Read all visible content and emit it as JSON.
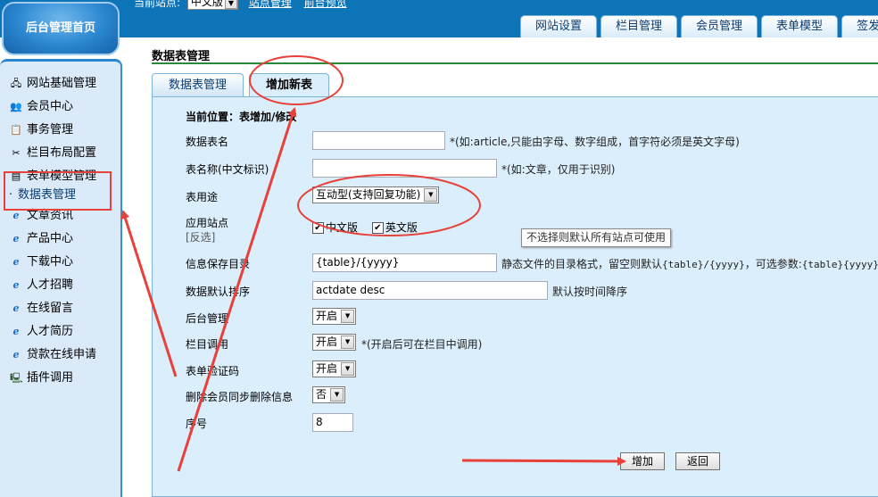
{
  "topbar": {
    "site_label": "当前站点:",
    "site_value": "中文版",
    "links": [
      "站点管理",
      "前台预览"
    ]
  },
  "top_nav": [
    "网站设置",
    "栏目管理",
    "会员管理",
    "表单模型",
    "签发信息"
  ],
  "home_button": "后台管理首页",
  "sidebar": {
    "items": [
      {
        "label": "网站基础管理",
        "icon": "network-icon"
      },
      {
        "label": "会员中心",
        "icon": "users-icon"
      },
      {
        "label": "事务管理",
        "icon": "clipboard-icon"
      },
      {
        "label": "栏目布局配置",
        "icon": "tools-icon"
      },
      {
        "label": "表单模型管理",
        "icon": "form-icon"
      },
      {
        "label": "数据表管理",
        "icon": "dot"
      },
      {
        "label": "文章资讯",
        "icon": "ie-icon"
      },
      {
        "label": "产品中心",
        "icon": "ie-icon"
      },
      {
        "label": "下载中心",
        "icon": "ie-icon"
      },
      {
        "label": "人才招聘",
        "icon": "ie-icon"
      },
      {
        "label": "在线留言",
        "icon": "ie-icon"
      },
      {
        "label": "人才简历",
        "icon": "ie-icon"
      },
      {
        "label": "贷款在线申请",
        "icon": "ie-icon"
      },
      {
        "label": "插件调用",
        "icon": "computer-icon"
      }
    ]
  },
  "main": {
    "page_title": "数据表管理",
    "tabs": [
      "数据表管理",
      "增加新表"
    ],
    "breadcrumb": "当前位置：表增加/修改",
    "form": {
      "table_name": {
        "label": "数据表名",
        "value": "",
        "hint": "*(如:article,只能由字母、数字组成，首字符必须是英文字母)"
      },
      "display_name": {
        "label": "表名称(中文标识)",
        "value": "",
        "hint": "*(如:文章，仅用于识别)"
      },
      "usage": {
        "label": "表用途",
        "value": "互动型(支持回复功能)"
      },
      "sites": {
        "label": "应用站点",
        "sublabel": "[反选]",
        "options": [
          {
            "label": "中文版",
            "checked": true
          },
          {
            "label": "英文版",
            "checked": true
          }
        ]
      },
      "save_dir": {
        "label": "信息保存目录",
        "value": "{table}/{yyyy}",
        "hint_prefix": "静态文件的目录格式，留空则默认",
        "hint_default": "{table}/{yyyy}",
        "hint_mid": "，可选参数:",
        "hint_params": "{table}{yyyy}{mm}"
      },
      "sort": {
        "label": "数据默认排序",
        "value": "actdate desc",
        "hint": "默认按时间降序"
      },
      "admin": {
        "label": "后台管理",
        "value": "开启"
      },
      "column_call": {
        "label": "栏目调用",
        "value": "开启",
        "hint": "*(开启后可在栏目中调用)"
      },
      "captcha": {
        "label": "表单验证码",
        "value": "开启"
      },
      "delete_sync": {
        "label": "删除会员同步删除信息",
        "value": "否"
      },
      "order": {
        "label": "序号",
        "value": "8"
      }
    },
    "tooltip": "不选择则默认所有站点可使用",
    "buttons": {
      "add": "增加",
      "back": "返回"
    }
  },
  "colors": {
    "header_blue": "#0d74b8",
    "sidebar_bg": "#dbeaf8",
    "panel_bg": "#dbeefb",
    "annotation_red": "#e8403a",
    "title_line": "#2a8a3a"
  }
}
